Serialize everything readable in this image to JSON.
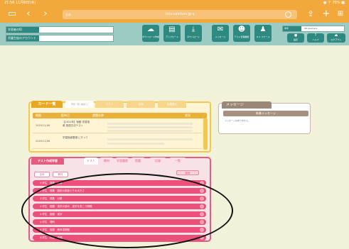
{
  "status": {
    "time": "21:56  11月6日(木)",
    "right": "● 〒 75% ■"
  },
  "browser": {
    "url_prefix": "ぁあ",
    "url": "tms.calchon.jp s",
    "icons": [
      "sidebar-icon",
      "back-icon",
      "forward-icon",
      "share-icon",
      "plus-icon",
      "tabs-icon"
    ]
  },
  "header": {
    "accounts": [
      {
        "label": "学習者のID",
        "value": ""
      },
      {
        "label": "児童生徒のアカウント",
        "value": ""
      }
    ],
    "tools": [
      {
        "label": "ダウンロード作成",
        "icon": "cloud-icon"
      },
      {
        "label": "アップロード",
        "icon": "print-icon"
      },
      {
        "label": "ダウンロード",
        "icon": "download-icon"
      },
      {
        "label": "メッセージ",
        "icon": "mail-icon"
      },
      {
        "label": "テスト管理機能",
        "icon": "group-icon"
      },
      {
        "label": "マイ スケール",
        "icon": "scale-icon"
      }
    ],
    "right_label": "学年",
    "right_value": "IDI teachers",
    "right_buttons": [
      {
        "label": "設定",
        "icon": "person-icon"
      },
      {
        "label": "ヘルプ",
        "icon": "help-icon"
      },
      {
        "label": "ログアウト",
        "icon": "exit-icon"
      }
    ]
  },
  "schedule": {
    "title": "カード一覧",
    "tabs": [
      "予定一覧 (未完了)",
      "テスト",
      "返却",
      "結果表示"
    ],
    "columns": [
      "期限",
      "配布日",
      "課題名称",
      "状況"
    ],
    "rows": [
      {
        "date": "2020/11/06",
        "name": "【2022年】宿題 学習指導 英語文法テスト",
        "bars": 4
      },
      {
        "date": "2020/11/06",
        "name": "学習指導要領 にそって",
        "bars": 2
      }
    ]
  },
  "message": {
    "tab": "メッセージ",
    "header": "新着メッセージ",
    "text": "メッセージはありません。"
  },
  "pink_panel": {
    "tab": "テスト作成学習",
    "tabs": [
      "テスト",
      "教材",
      "学習履歴",
      "宿題",
      "記録",
      "一覧"
    ],
    "subtabs": [
      "全体",
      "教材"
    ],
    "search": "検索",
    "items": [
      "小学生　算数　計算",
      "小学生　算数　図形の角度とその大きさ",
      "小学生　算数　分数",
      "小学生　国語　漢字の読み　漢字を書こう問題",
      "小学生　国語　漢字",
      "小学生　理科",
      "小学生　国語　教科書問題",
      "小学生　社会　地図"
    ]
  }
}
